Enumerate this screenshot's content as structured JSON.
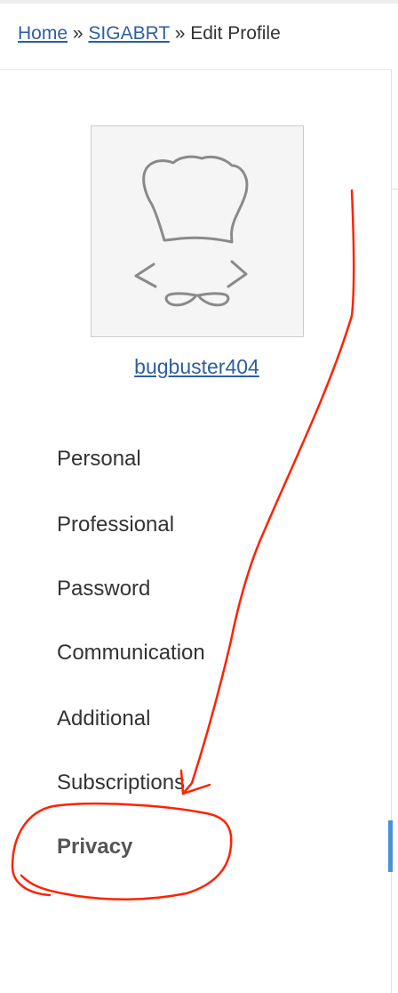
{
  "breadcrumb": {
    "home": "Home",
    "separator_1": "»",
    "user": "SIGABRT",
    "separator_2": "»",
    "current": "Edit Profile"
  },
  "profile": {
    "username": "bugbuster404",
    "avatar_icon": "chef-hat-mustache-icon"
  },
  "nav": {
    "items": [
      {
        "label": "Personal",
        "active": false
      },
      {
        "label": "Professional",
        "active": false
      },
      {
        "label": "Password",
        "active": false
      },
      {
        "label": "Communication",
        "active": false
      },
      {
        "label": "Additional",
        "active": false
      },
      {
        "label": "Subscriptions",
        "active": false
      },
      {
        "label": "Privacy",
        "active": true
      }
    ]
  },
  "annotation": {
    "color": "#ff2200",
    "icons": [
      "arrow-icon",
      "circle-highlight-icon"
    ]
  },
  "colors": {
    "link": "#2e5f9f",
    "text": "#333333",
    "scroll_indicator": "#4a90d9"
  }
}
